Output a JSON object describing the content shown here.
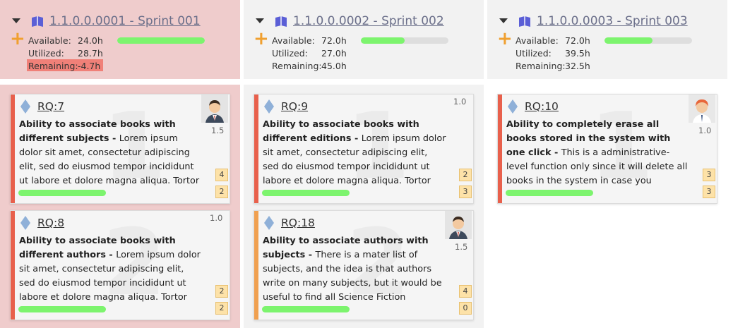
{
  "colors": {
    "accent_green": "#7df46e",
    "plus_orange": "#f0a030",
    "overrun_red": "#f08078"
  },
  "sprints": [
    {
      "title": "1.1.0.0.0001 - Sprint 001",
      "available_label": "Available:",
      "available": "24.0h",
      "utilized_label": "Utilized:",
      "utilized": "28.7h",
      "remaining_label": "Remaining:",
      "remaining": "-4.7h",
      "progress": 1.0,
      "overrun": true,
      "cards": [
        {
          "id": "RQ:7",
          "title": "Ability to associate books with different subjects",
          "sep": " - ",
          "desc": "Lorem ipsum dolor sit amet, consectetur adipiscing elit, sed do eiusmod tempor incididunt ut labore et dolore magna aliqua. Tortor",
          "estimate": "1.5",
          "badge1": "4",
          "badge2": "2",
          "avatar": "avatar-man-icon",
          "watermark": "1",
          "priority_color": "#e8604c"
        },
        {
          "id": "RQ:8",
          "title": "Ability to associate books with different authors",
          "sep": " - ",
          "desc": "Lorem ipsum dolor sit amet, consectetur adipiscing elit, sed do eiusmod tempor incididunt ut labore et dolore magna aliqua. Tortor",
          "estimate": "1.0",
          "badge1": "2",
          "badge2": "2",
          "avatar": "",
          "watermark": "2",
          "priority_color": "#e8604c"
        }
      ]
    },
    {
      "title": "1.1.0.0.0002 - Sprint 002",
      "available_label": "Available:",
      "available": "72.0h",
      "utilized_label": "Utilized:",
      "utilized": "27.0h",
      "remaining_label": "Remaining:",
      "remaining": "45.0h",
      "progress": 0.5,
      "overrun": false,
      "cards": [
        {
          "id": "RQ:9",
          "title": "Ability to associate books with different editions",
          "sep": " - ",
          "desc": "Lorem ipsum dolor sit amet, consectetur adipiscing elit, sed do eiusmod tempor incididunt ut labore et dolore magna aliqua. Tortor",
          "estimate": "1.0",
          "badge1": "2",
          "badge2": "3",
          "avatar": "",
          "watermark": "1",
          "priority_color": "#e8604c"
        },
        {
          "id": "RQ:18",
          "title": "Ability to associate authors with subjects",
          "sep": " - ",
          "desc": "There is a mater list of subjects, and the idea is that authors write on many subjects, but it would be useful to find all Science Fiction",
          "estimate": "1.5",
          "badge1": "4",
          "badge2": "0",
          "avatar": "avatar-man-icon",
          "watermark": "2",
          "priority_color": "#f0a050"
        }
      ]
    },
    {
      "title": "1.1.0.0.0003 - Sprint 003",
      "available_label": "Available:",
      "available": "72.0h",
      "utilized_label": "Utilized:",
      "utilized": "39.5h",
      "remaining_label": "Remaining:",
      "remaining": "32.5h",
      "progress": 0.55,
      "overrun": false,
      "cards": [
        {
          "id": "RQ:10",
          "title": "Ability to completely erase all books stored in the system with one click",
          "sep": " - ",
          "desc": " This is a administrative-level function only since it will delete all books in the system in case you",
          "estimate": "1.0",
          "badge1": "3",
          "badge2": "3",
          "avatar": "avatar-redhair-icon",
          "watermark": "1",
          "priority_color": "#e8604c"
        }
      ]
    }
  ]
}
